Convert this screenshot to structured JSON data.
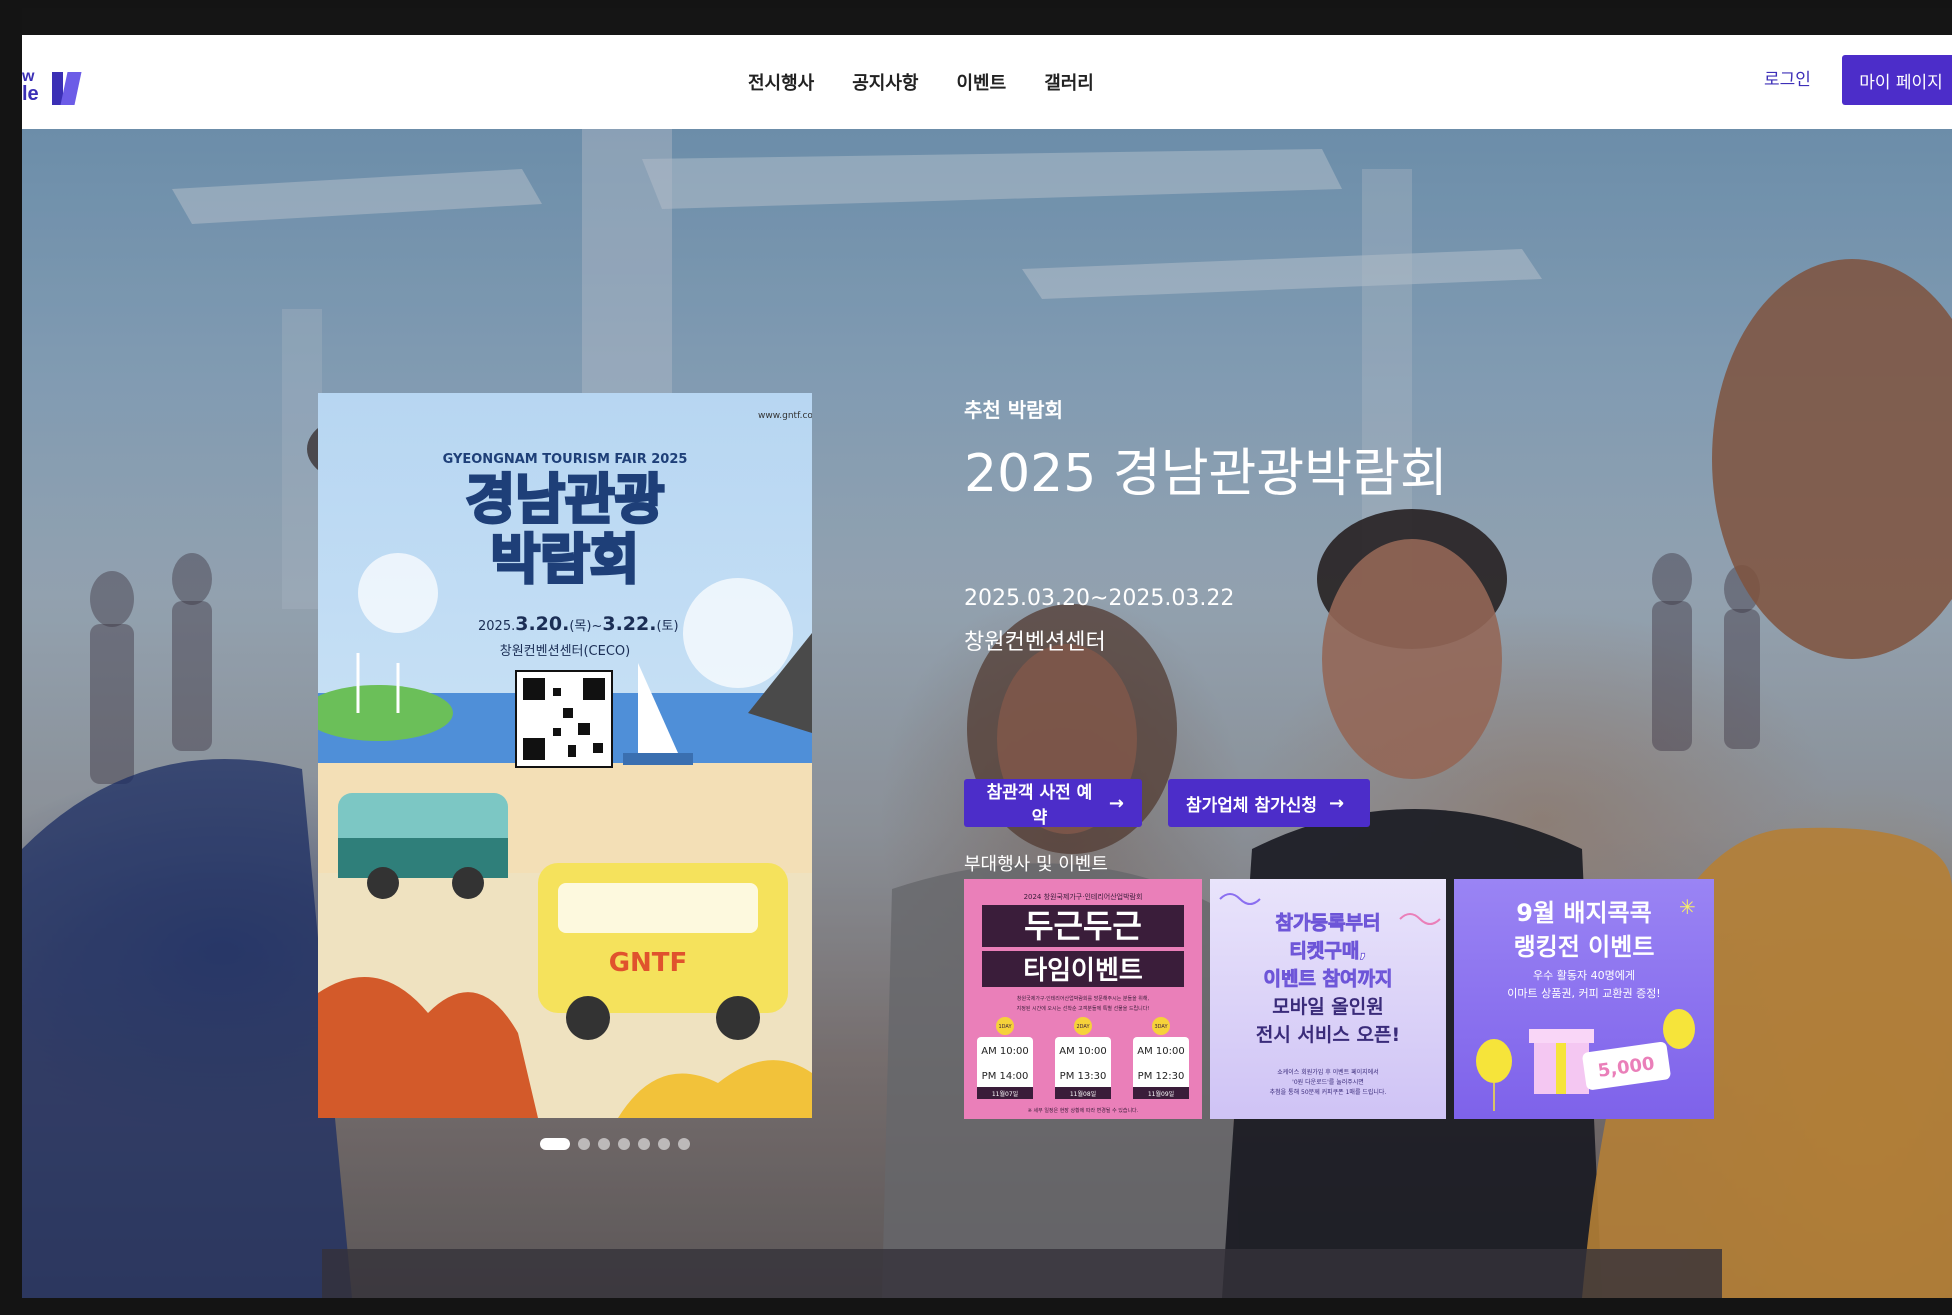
{
  "header": {
    "logo_top": "w",
    "logo_bottom": "le",
    "nav": [
      "전시행사",
      "공지사항",
      "이벤트",
      "갤러리"
    ],
    "login": "로그인",
    "mypage": "마이 페이지"
  },
  "hero": {
    "recommend": "추천 박람회",
    "title": "2025 경남관광박람회",
    "date": "2025.03.20~2025.03.22",
    "venue": "창원컨벤션센터",
    "btn_visitor": "참관객 사전 예약",
    "btn_exhibitor": "참가업체 참가신청",
    "arrow": "→",
    "side_events_label": "부대행사 및 이벤트",
    "slide_dots": 7,
    "active_dot": 1
  },
  "poster": {
    "url": "www.gntf.co.kr",
    "en_title": "GYEONGNAM TOURISM FAIR 2025",
    "title_line1": "경남관광",
    "title_line2": "박람회",
    "date_prefix": "2025.",
    "date_start": "3.20.",
    "day_start": "(목)",
    "date_sep": "~",
    "date_end": "3.22.",
    "day_end": "(토)",
    "venue": "창원컨벤션센터(CECO)",
    "van_text": "GNTF"
  },
  "events": [
    {
      "top_line": "2024 창원국제가구·인테리어산업박람회",
      "title1": "두근두근",
      "title2": "타임이벤트",
      "desc1": "창원국제가구·인테리어산업박람회를 방문해주시는 분들을 위해,",
      "desc2": "지정된 시간에 오시는 선착순 고객분들께 특별 선물을 드립니다!",
      "days": [
        {
          "label": "1DAY",
          "am": "AM 10:00",
          "pm": "PM 14:00",
          "date": "11월07일"
        },
        {
          "label": "2DAY",
          "am": "AM 10:00",
          "pm": "PM 13:30",
          "date": "11월08일"
        },
        {
          "label": "3DAY",
          "am": "AM 10:00",
          "pm": "PM 12:30",
          "date": "11월09일"
        }
      ],
      "footer": "※ 세부 일정은 현장 상황에 따라 변경될 수 있습니다."
    },
    {
      "l1": "참가등록부터",
      "l2": "티켓구매,",
      "l3": "이벤트 참여까지",
      "l4": "모바일 올인원",
      "l5": "전시 서비스 오픈!",
      "s1": "쇼케이스 회원가입 후 이벤트 페이지에서",
      "s2": "'0원 다운로드'를 눌러주시면",
      "s3": "추첨을 통해 50분께 커피쿠폰 1매를 드립니다."
    },
    {
      "l1": "9월 배지콕콕",
      "l2": "랭킹전 이벤트",
      "s1": "우수 활동자 40명에게",
      "s2": "이마트 상품권, 커피 교환권 증정!",
      "ticket": "5,000"
    }
  ],
  "colors": {
    "primary": "#4c2dc9",
    "accent_pink": "#ea7fb9",
    "accent_purple": "#8b6ff0"
  }
}
